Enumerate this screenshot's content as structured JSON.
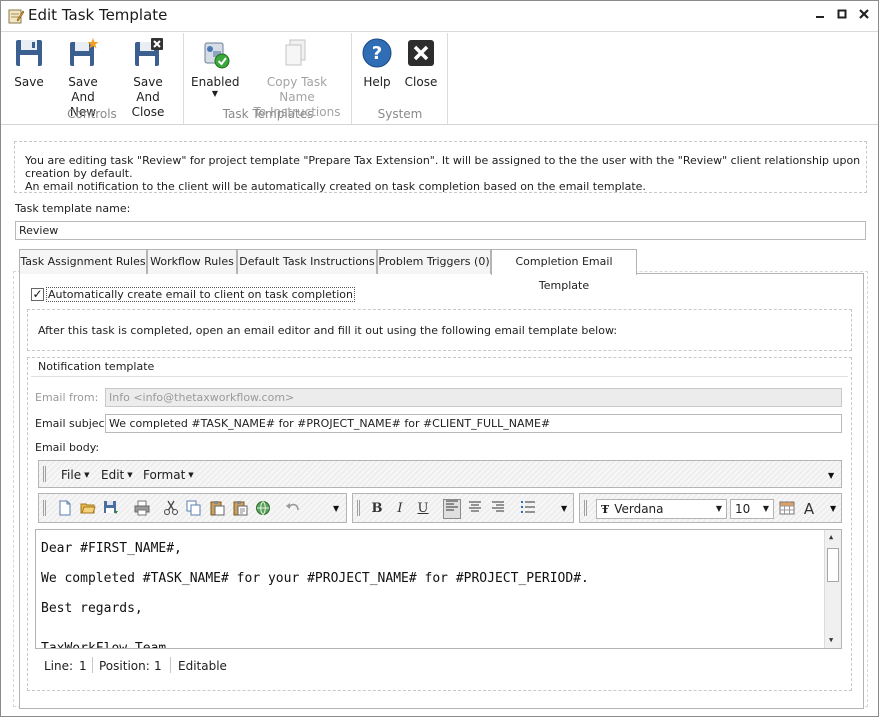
{
  "window": {
    "title": "Edit Task Template",
    "controls": [
      "minimize",
      "maximize",
      "close"
    ]
  },
  "ribbon": {
    "groups": [
      {
        "label": "Controls",
        "buttons": [
          {
            "label_line1": "Save",
            "label_line2": "",
            "icon": "floppy-disk-icon"
          },
          {
            "label_line1": "Save And",
            "label_line2": "New",
            "icon": "floppy-new-icon"
          },
          {
            "label_line1": "Save And",
            "label_line2": "Close",
            "icon": "floppy-close-icon"
          }
        ]
      },
      {
        "label": "Task Templates",
        "buttons": [
          {
            "label_line1": "Enabled",
            "label_line2": "",
            "icon": "enabled-toggle-icon",
            "dropdown": true
          },
          {
            "label_line1": "Copy Task Name",
            "label_line2": "To Instructions",
            "icon": "copy-document-icon",
            "disabled": true
          }
        ]
      },
      {
        "label": "System",
        "buttons": [
          {
            "label_line1": "Help",
            "label_line2": "",
            "icon": "help-icon"
          },
          {
            "label_line1": "Close",
            "label_line2": "",
            "icon": "close-x-icon"
          }
        ]
      }
    ]
  },
  "info": {
    "line1": "You are editing task \"Review\" for project template \"Prepare Tax Extension\". It will be assigned to the the user with the \"Review\" client relationship upon creation by default.",
    "line2": "An email notification to the client will be automatically created on task completion based on the email template."
  },
  "task_name": {
    "label": "Task template name:",
    "value": "Review"
  },
  "tabs": [
    {
      "label": "Task Assignment Rules",
      "active": false
    },
    {
      "label": "Workflow Rules",
      "active": false
    },
    {
      "label": "Default Task Instructions",
      "active": false
    },
    {
      "label": "Problem Triggers (0)",
      "active": false
    },
    {
      "label": "Completion Email Template",
      "active": true
    }
  ],
  "completion_email": {
    "auto_create_label": "Automatically create email to client on task completion",
    "auto_create_checked": true,
    "instruction": "After this task is completed, open an email editor and fill it out using the following email template below:",
    "section_title": "Notification template",
    "email_from_label": "Email from:",
    "email_from_value": "Info <info@thetaxworkflow.com>",
    "email_subject_label": "Email subject:",
    "email_subject_value": "We completed #TASK_NAME# for #PROJECT_NAME# for #CLIENT_FULL_NAME#",
    "email_body_label": "Email body:"
  },
  "editor": {
    "menus": [
      "File",
      "Edit",
      "Format"
    ],
    "font_name": "Verdana",
    "font_size": "10",
    "body_lines": [
      "Dear #FIRST_NAME#,",
      "We completed #TASK_NAME# for your #PROJECT_NAME# for #PROJECT_PERIOD#.",
      "Best regards,",
      "TaxWorkFlow Team"
    ],
    "status": {
      "line_label": "Line:",
      "line_value": "1",
      "position_label": "Position:",
      "position_value": "1",
      "mode": "Editable"
    }
  },
  "colors": {
    "accent_blue": "#2f6db5",
    "border": "#b4b4b4",
    "disabled_text": "#a3a3a3"
  }
}
